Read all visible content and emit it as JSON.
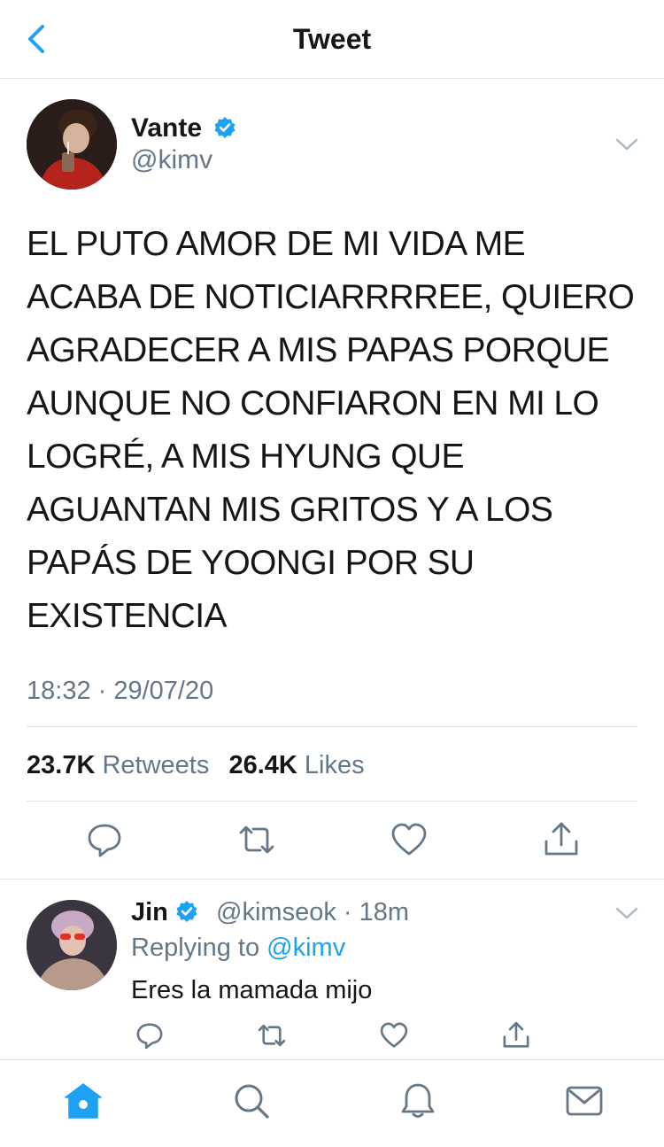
{
  "header": {
    "title": "Tweet"
  },
  "tweet": {
    "author_name": "Vante",
    "author_handle": "@kimv",
    "text": "EL PUTO AMOR DE MI VIDA ME ACABA DE NOTICIARRRREE, QUIERO AGRADECER A MIS PAPAS PORQUE AUNQUE NO CONFIARON EN MI LO LOGRÉ, A MIS HYUNG QUE AGUANTAN MIS GRITOS Y A LOS PAPÁS DE YOONGI POR SU EXISTENCIA",
    "timestamp": "18:32 · 29/07/20",
    "retweets_count": "23.7K",
    "retweets_label": "Retweets",
    "likes_count": "26.4K",
    "likes_label": "Likes"
  },
  "reply": {
    "author_name": "Jin",
    "author_handle": "@kimseok",
    "time": "· 18m",
    "replying_to_label": "Replying to",
    "replying_to_handle": "@kimv",
    "text": "Eres la mamada mijo"
  },
  "colors": {
    "accent": "#1da1f2",
    "secondary_text": "#657786",
    "divider": "#dfe3e6"
  },
  "icons": [
    "back-icon",
    "verified-icon",
    "chevron-down-icon",
    "reply-icon",
    "retweet-icon",
    "like-icon",
    "share-icon",
    "home-icon",
    "search-icon",
    "notifications-icon",
    "messages-icon"
  ]
}
